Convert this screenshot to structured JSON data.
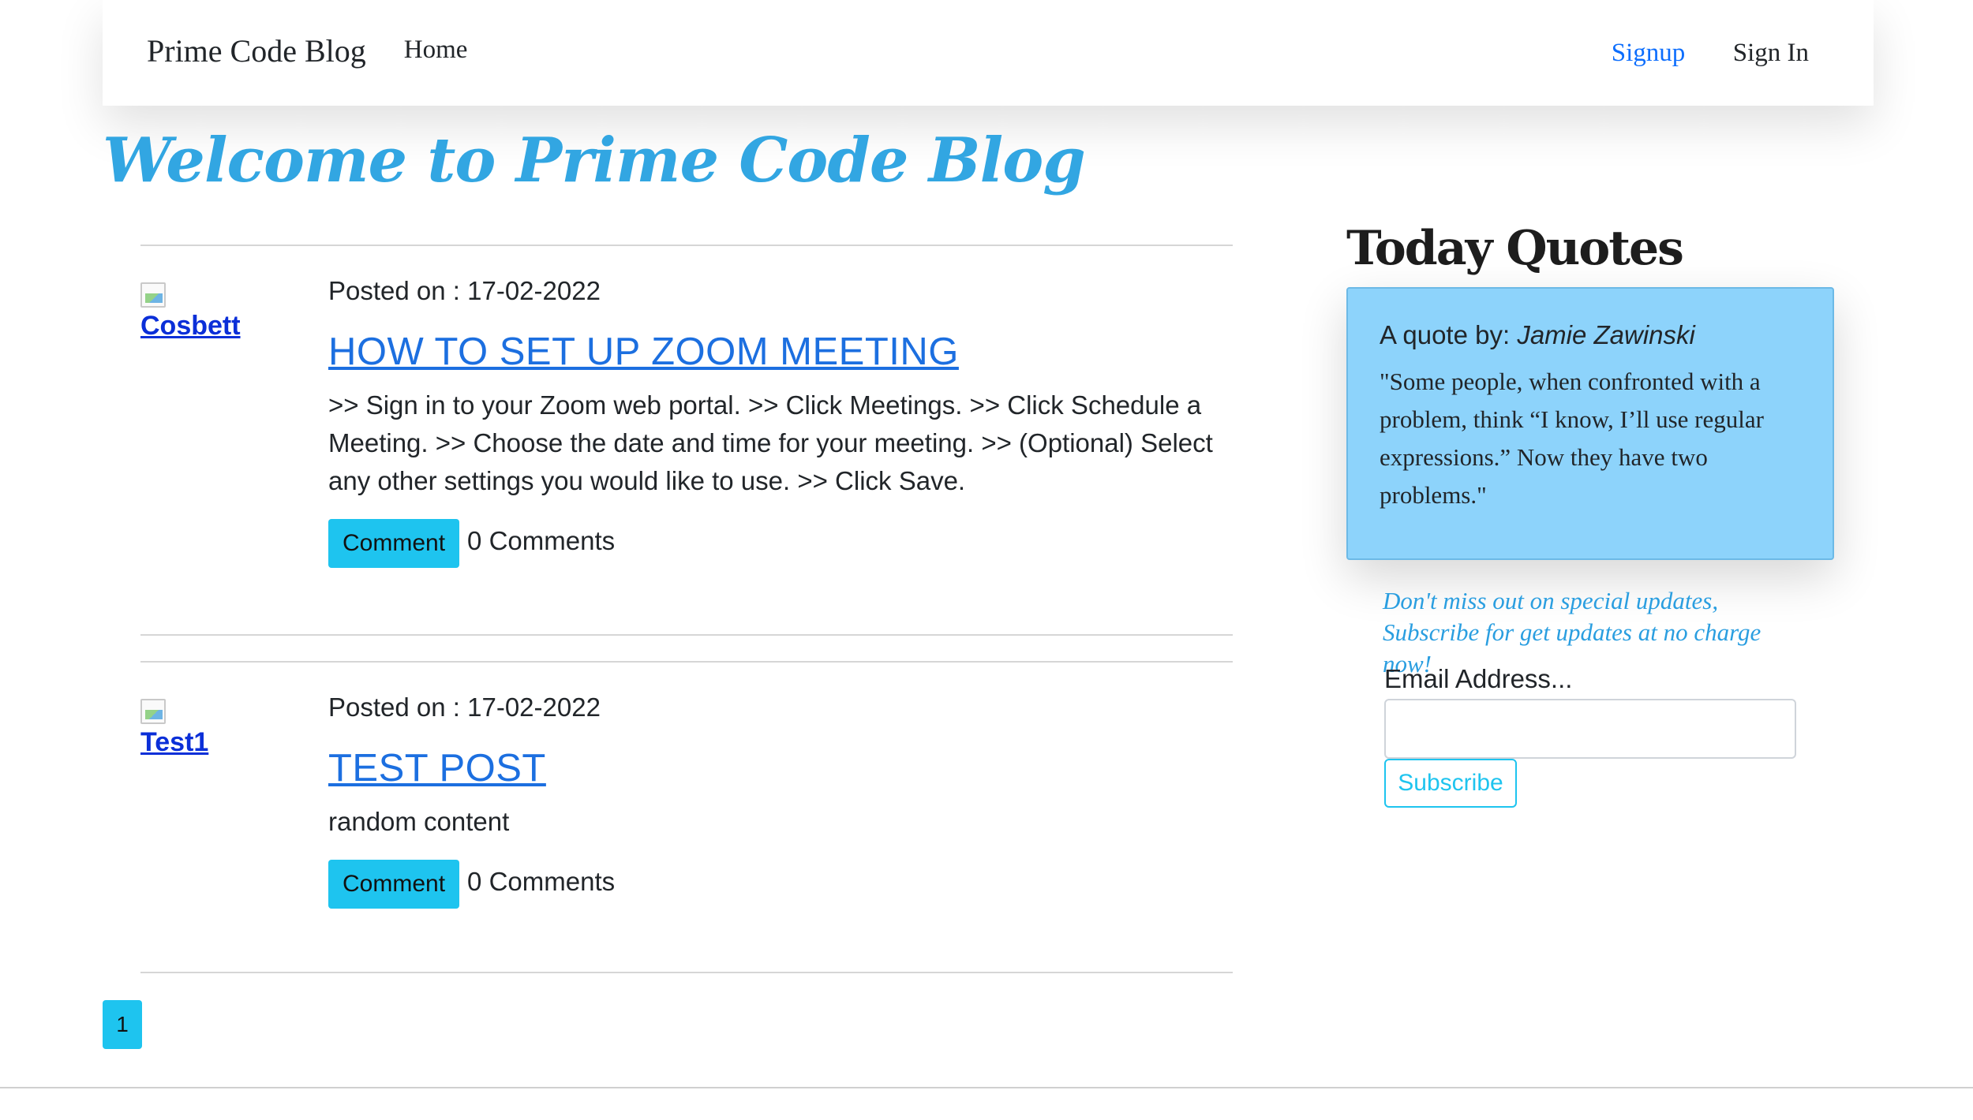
{
  "navbar": {
    "brand": "Prime Code Blog",
    "home": "Home",
    "signup": "Signup",
    "signin": "Sign In"
  },
  "welcome": "Welcome to Prime Code Blog",
  "posts": [
    {
      "author": "Cosbett",
      "posted": "Posted on : 17-02-2022",
      "title": "HOW TO SET UP ZOOM MEETING",
      "content": ">> Sign in to your Zoom web portal. >> Click Meetings. >> Click Schedule a Meeting. >> Choose the date and time for your meeting. >> (Optional) Select any other settings you would like to use. >> Click Save.",
      "comment_button": "Comment",
      "comments": "0 Comments"
    },
    {
      "author": "Test1",
      "posted": "Posted on : 17-02-2022",
      "title": "TEST POST",
      "content": "random content",
      "comment_button": "Comment",
      "comments": "0 Comments"
    }
  ],
  "pagination": {
    "current": "1"
  },
  "sidebar": {
    "title": "Today Quotes",
    "quote_by_label": "A quote by: ",
    "quote_author": "Jamie Zawinski",
    "quote_text": "\"Some people, when confronted with a problem, think “I know, I’ll use regular expressions.” Now they have two problems.\"",
    "subscribe_note": "Don't miss out on special updates, Subscribe for get updates at no charge now!",
    "email_label": "Email Address...",
    "email_value": "",
    "subscribe_button": "Subscribe"
  },
  "colors": {
    "accent": "#1ec4ef",
    "link": "#1c6fe0",
    "welcome": "#32a6e2",
    "quote_bg": "#8dd3fb"
  }
}
